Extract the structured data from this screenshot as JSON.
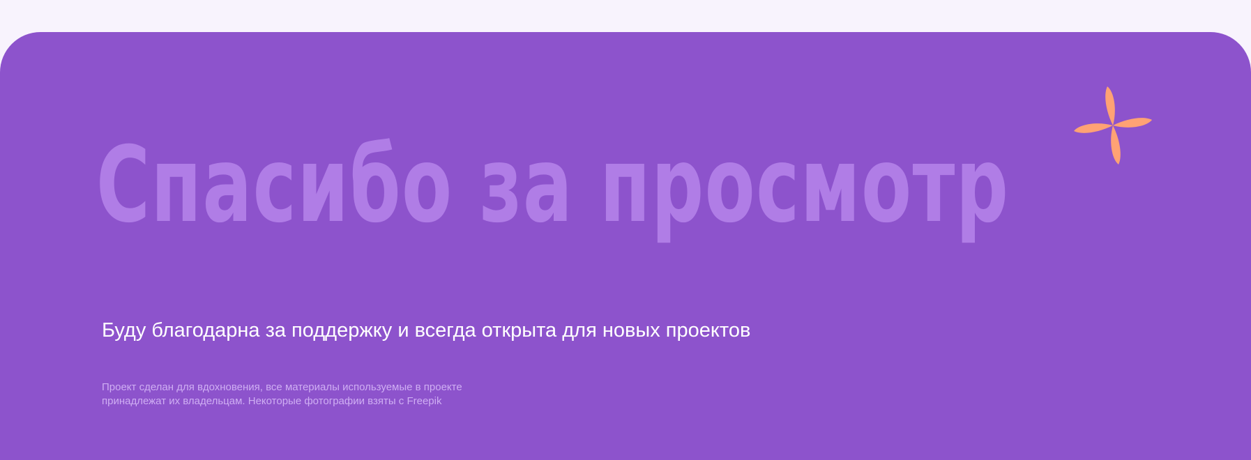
{
  "slide": {
    "headline": "Спасибо за просмотр",
    "subtitle": "Буду благодарна за поддержку и всегда открыта для новых проектов",
    "credits": {
      "line1": "Проект сделан для вдохновения, все материалы используемые в проекте",
      "line2": "принадлежат их владельцам. Некоторые фотографии взяты с Freepik"
    }
  },
  "colors": {
    "page_background": "#f8f3fd",
    "panel": "#8d53cc",
    "headline": "#b07de6",
    "subtitle": "#ffffff",
    "credits": "#cfaef3",
    "sparkle": "#ffa274"
  },
  "icons": {
    "decoration": "sparkle-icon"
  }
}
